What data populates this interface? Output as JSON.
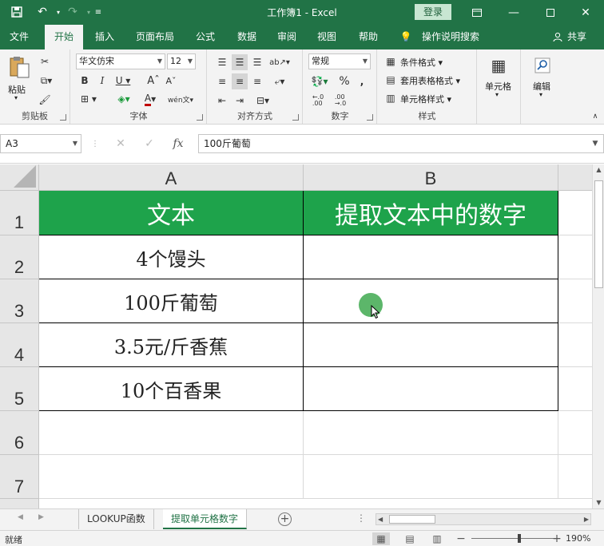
{
  "titlebar": {
    "title": "工作簿1  -  Excel",
    "login_label": "登录",
    "save_icon": "save-icon",
    "undo_icon": "undo-icon",
    "redo_icon": "redo-icon"
  },
  "ribbon_tabs": {
    "file": "文件",
    "home": "开始",
    "insert": "插入",
    "page_layout": "页面布局",
    "formulas": "公式",
    "data": "数据",
    "review": "审阅",
    "view": "视图",
    "help": "帮助",
    "tell_me": "操作说明搜索",
    "share": "共享"
  },
  "ribbon": {
    "clipboard": {
      "paste": "粘贴",
      "label": "剪贴板"
    },
    "font": {
      "name": "华文仿宋",
      "size": "12",
      "label": "字体"
    },
    "alignment": {
      "label": "对齐方式"
    },
    "number": {
      "format": "常规",
      "label": "数字"
    },
    "styles": {
      "conditional": "条件格式",
      "table": "套用表格格式",
      "cell_styles": "单元格样式",
      "label": "样式"
    },
    "cells": {
      "label": "单元格"
    },
    "editing": {
      "label": "编辑"
    }
  },
  "formula_bar": {
    "name_box": "A3",
    "formula": "100斤葡萄"
  },
  "grid": {
    "columns": [
      "A",
      "B"
    ],
    "rows": [
      "1",
      "2",
      "3",
      "4",
      "5",
      "6",
      "7"
    ],
    "cells": {
      "A1": "文本",
      "B1": "提取文本中的数字",
      "A2": "4个馒头",
      "A3": "100斤葡萄",
      "A4": "3.5元/斤香蕉",
      "A5": "10个百香果"
    },
    "header_color": "#1ea34b"
  },
  "sheets": {
    "tab1": "LOOKUP函数",
    "tab2": "提取单元格数字"
  },
  "status": {
    "ready": "就绪",
    "zoom": "190%"
  }
}
